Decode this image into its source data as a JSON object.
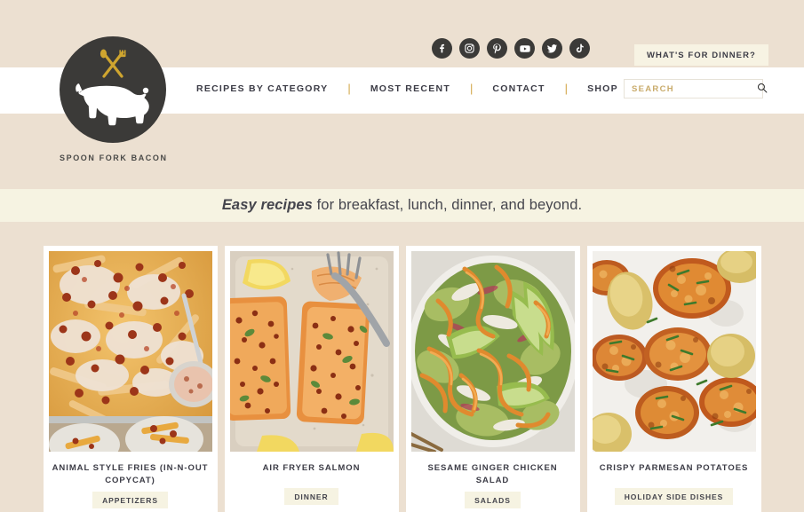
{
  "site": {
    "logo_name": "SPOON FORK BACON",
    "logo_icon": "pig-logo-icon"
  },
  "header": {
    "cta_label": "WHAT'S FOR DINNER?",
    "social": [
      {
        "name": "facebook-icon",
        "label": "Facebook"
      },
      {
        "name": "instagram-icon",
        "label": "Instagram"
      },
      {
        "name": "pinterest-icon",
        "label": "Pinterest"
      },
      {
        "name": "youtube-icon",
        "label": "YouTube"
      },
      {
        "name": "twitter-icon",
        "label": "Twitter"
      },
      {
        "name": "tiktok-icon",
        "label": "TikTok"
      }
    ],
    "nav": [
      {
        "label": "RECIPES BY CATEGORY"
      },
      {
        "label": "MOST RECENT"
      },
      {
        "label": "CONTACT"
      },
      {
        "label": "SHOP"
      }
    ],
    "nav_separator": "|",
    "search": {
      "placeholder": "SEARCH",
      "value": "",
      "icon": "search-icon"
    }
  },
  "tagline": {
    "emphasis": "Easy recipes",
    "rest": " for breakfast, lunch, dinner, and beyond."
  },
  "cards": [
    {
      "title": "ANIMAL STYLE FRIES (IN-N-OUT COPYCAT)",
      "tag": "APPETIZERS",
      "image_alt": "animal-style-fries-photo"
    },
    {
      "title": "AIR FRYER SALMON",
      "tag": "DINNER",
      "image_alt": "air-fryer-salmon-photo"
    },
    {
      "title": "SESAME GINGER CHICKEN SALAD",
      "tag": "SALADS",
      "image_alt": "sesame-ginger-chicken-salad-photo"
    },
    {
      "title": "CRISPY PARMESAN POTATOES",
      "tag": "HOLIDAY SIDE DISHES",
      "image_alt": "crispy-parmesan-potatoes-photo"
    }
  ],
  "colors": {
    "page_bg": "#ece0d1",
    "nav_bg": "#ffffff",
    "band_bg": "#f6f3e2",
    "accent_gold": "#d3a648",
    "dark": "#3b3a38",
    "text": "#3c3c46"
  }
}
